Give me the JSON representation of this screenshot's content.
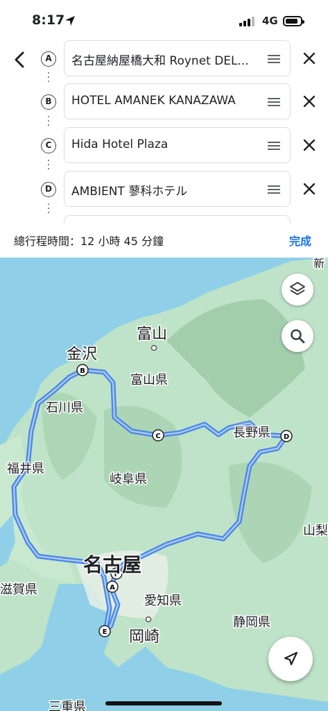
{
  "status_bar": {
    "time": "8:17",
    "network": "4G"
  },
  "stops": [
    {
      "letter": "A",
      "name": "名古屋納屋橋大和 Roynet DEL..."
    },
    {
      "letter": "B",
      "name": "HOTEL AMANEK KANAZAWA"
    },
    {
      "letter": "C",
      "name": "Hida Hotel Plaza"
    },
    {
      "letter": "D",
      "name": "AMBIENT 蓼科ホテル"
    }
  ],
  "summary": {
    "total_time": "總行程時間：12 小時 45 分鐘",
    "done_label": "完成"
  },
  "map": {
    "labels": {
      "toyama_city": "富山",
      "kanazawa": "金沢",
      "toyama_pref": "富山県",
      "ishikawa": "石川県",
      "nagano": "長野県",
      "fukui": "福井県",
      "gifu": "岐阜県",
      "nagoya": "名古屋",
      "shiga": "滋賀県",
      "aichi": "愛知県",
      "okazaki": "岡崎",
      "shizuoka": "静岡県",
      "yamanashi": "山梨",
      "mie": "三重県",
      "niigata_partial": "新"
    },
    "markers": [
      "A",
      "B",
      "C",
      "D",
      "E",
      "F"
    ],
    "route_color": "#4a86e8"
  },
  "colors": {
    "accent": "#1a73e8",
    "land": "#bfe3c8",
    "water": "#8fd0e8"
  }
}
